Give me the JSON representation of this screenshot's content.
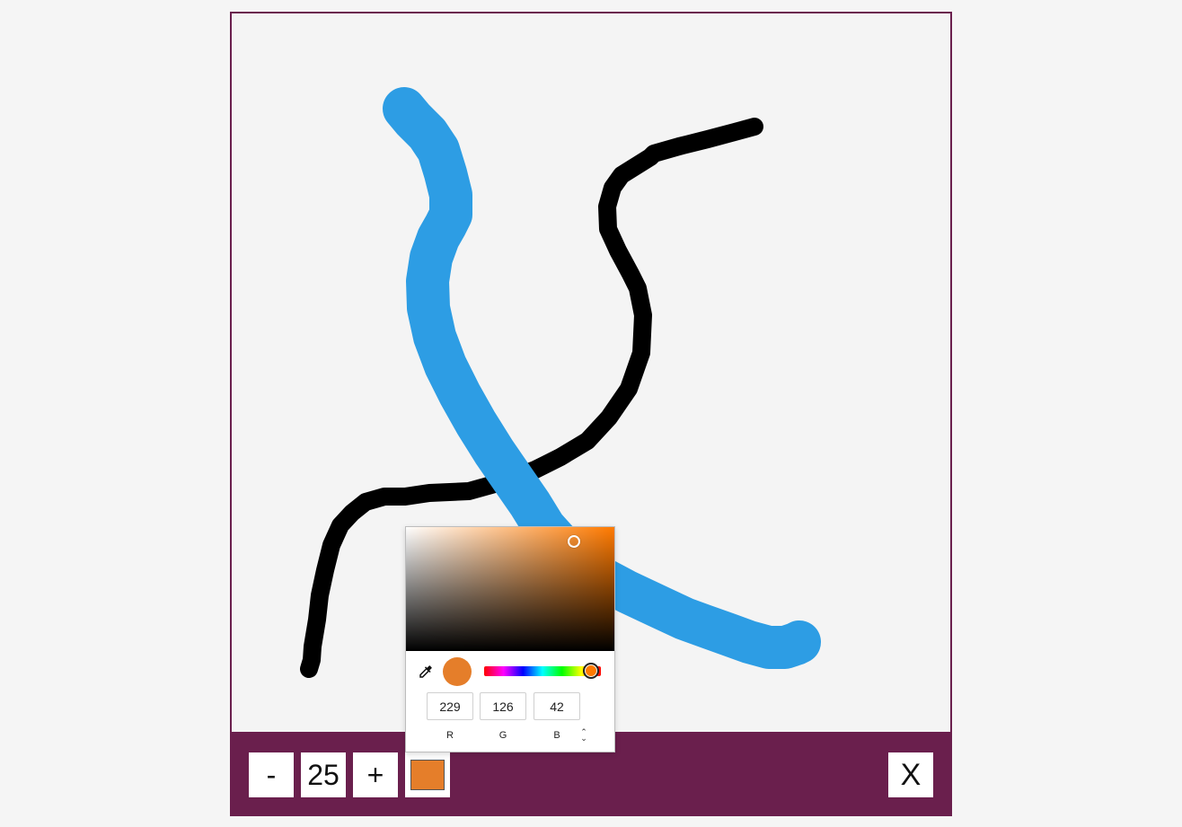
{
  "toolbar": {
    "minus_label": "-",
    "brush_size": "25",
    "plus_label": "+",
    "close_label": "X",
    "current_color": "#e57e2a"
  },
  "canvas": {
    "background": "#f4f4f4",
    "strokes": [
      {
        "color": "#000000",
        "description": "thin black curve"
      },
      {
        "color": "#2d9de4",
        "description": "thick blue curve"
      }
    ]
  },
  "color_picker": {
    "hue_color": "#ff7a00",
    "selected_color": "#e57e2a",
    "r": "229",
    "g": "126",
    "b": "42",
    "r_label": "R",
    "g_label": "G",
    "b_label": "B",
    "eyedropper_icon": "eyedropper-icon",
    "format_toggle_icon": "up-down-chevron-icon"
  },
  "colors": {
    "accent": "#6a1f4d",
    "blue_stroke": "#2d9de4",
    "black_stroke": "#000000"
  }
}
